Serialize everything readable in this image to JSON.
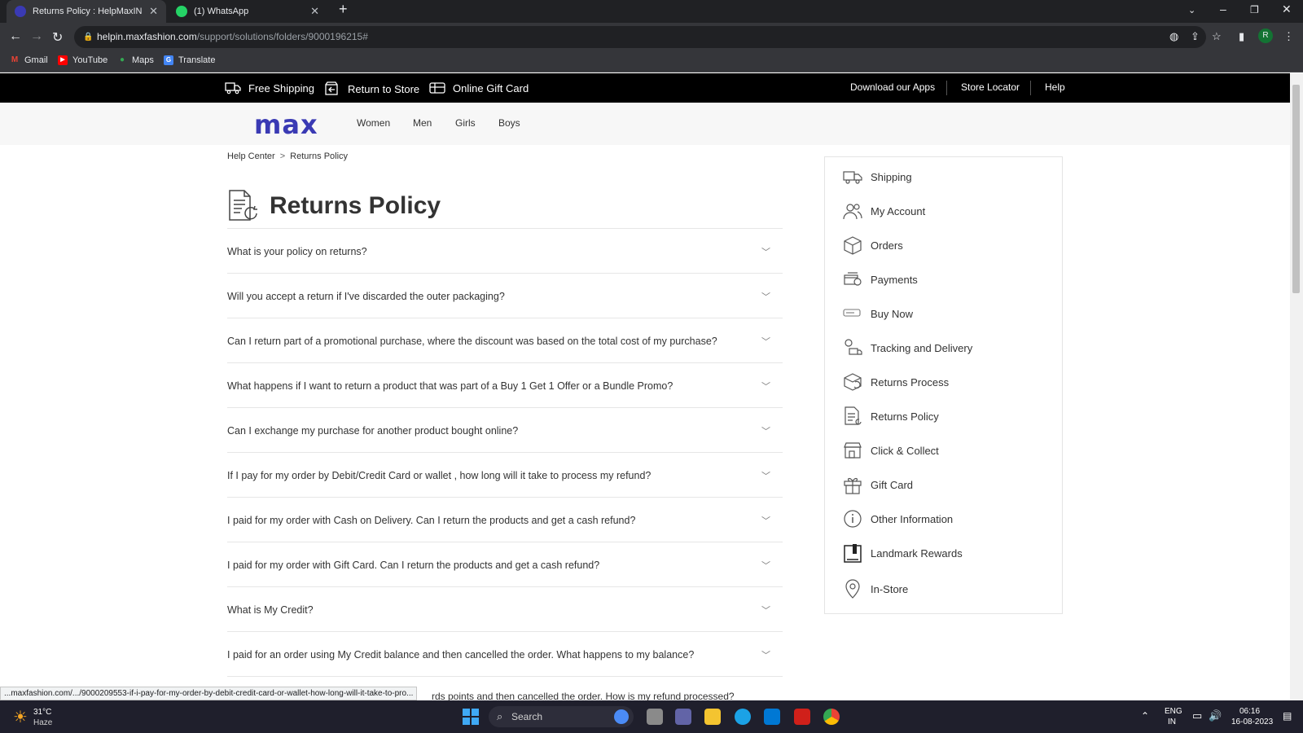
{
  "browser": {
    "tabs": [
      {
        "title": "Returns Policy : HelpMaxIN"
      },
      {
        "title": "(1) WhatsApp"
      }
    ],
    "url_host": "helpin.maxfashion.com",
    "url_path": "/support/solutions/folders/9000196215#",
    "profile_initial": "R",
    "bookmarks": [
      "Gmail",
      "YouTube",
      "Maps",
      "Translate"
    ]
  },
  "topstrip": {
    "free_shipping": "Free Shipping",
    "return_to_store": "Return to Store",
    "online_gift_card": "Online Gift Card",
    "download_apps": "Download our Apps",
    "store_locator": "Store Locator",
    "help": "Help"
  },
  "header": {
    "logo": "max",
    "nav": [
      "Women",
      "Men",
      "Girls",
      "Boys"
    ]
  },
  "breadcrumb": {
    "home": "Help Center",
    "sep": ">",
    "current": "Returns Policy"
  },
  "page_title": "Returns Policy",
  "faq": [
    "What is your policy on returns?",
    "Will you accept a return if I've discarded the outer packaging?",
    "Can I return part of a promotional purchase, where the discount was based on the total cost of my purchase?",
    "What happens if I want to return a product that was part of a Buy 1 Get 1 Offer or a Bundle Promo?",
    "Can I exchange my purchase for another product bought online?",
    "If I pay for my order by Debit/Credit Card or wallet , how long will it take to process my refund?",
    "I paid for my order with Cash on Delivery. Can I return the products and get a cash refund?",
    "I paid for my order with Gift Card. Can I return the products and get a cash refund?",
    "What is My Credit?",
    "I paid for an order using My Credit balance and then cancelled the order. What happens to my balance?"
  ],
  "faq_partial": "rds points and then cancelled the order. How is my refund processed?",
  "sidebar": [
    {
      "label": "Shipping",
      "icon": "truck-icon"
    },
    {
      "label": "My Account",
      "icon": "users-icon"
    },
    {
      "label": "Orders",
      "icon": "box-icon"
    },
    {
      "label": "Payments",
      "icon": "payment-icon"
    },
    {
      "label": "Buy Now",
      "icon": "card-icon"
    },
    {
      "label": "Tracking and Delivery",
      "icon": "tracking-icon"
    },
    {
      "label": "Returns Process",
      "icon": "return-box-icon"
    },
    {
      "label": "Returns Policy",
      "icon": "document-icon"
    },
    {
      "label": "Click & Collect",
      "icon": "store-icon"
    },
    {
      "label": "Gift Card",
      "icon": "gift-icon"
    },
    {
      "label": "Other Information",
      "icon": "info-icon"
    },
    {
      "label": "Landmark Rewards",
      "icon": "rewards-icon"
    },
    {
      "label": "In-Store",
      "icon": "location-pin-icon"
    }
  ],
  "status_url": "...maxfashion.com/.../9000209553-if-i-pay-for-my-order-by-debit-credit-card-or-wallet-how-long-will-it-take-to-pro...",
  "taskbar": {
    "temperature": "31°C",
    "weather": "Haze",
    "search_placeholder": "Search",
    "lang": "ENG",
    "region": "IN",
    "time": "06:16",
    "date": "16-08-2023"
  }
}
